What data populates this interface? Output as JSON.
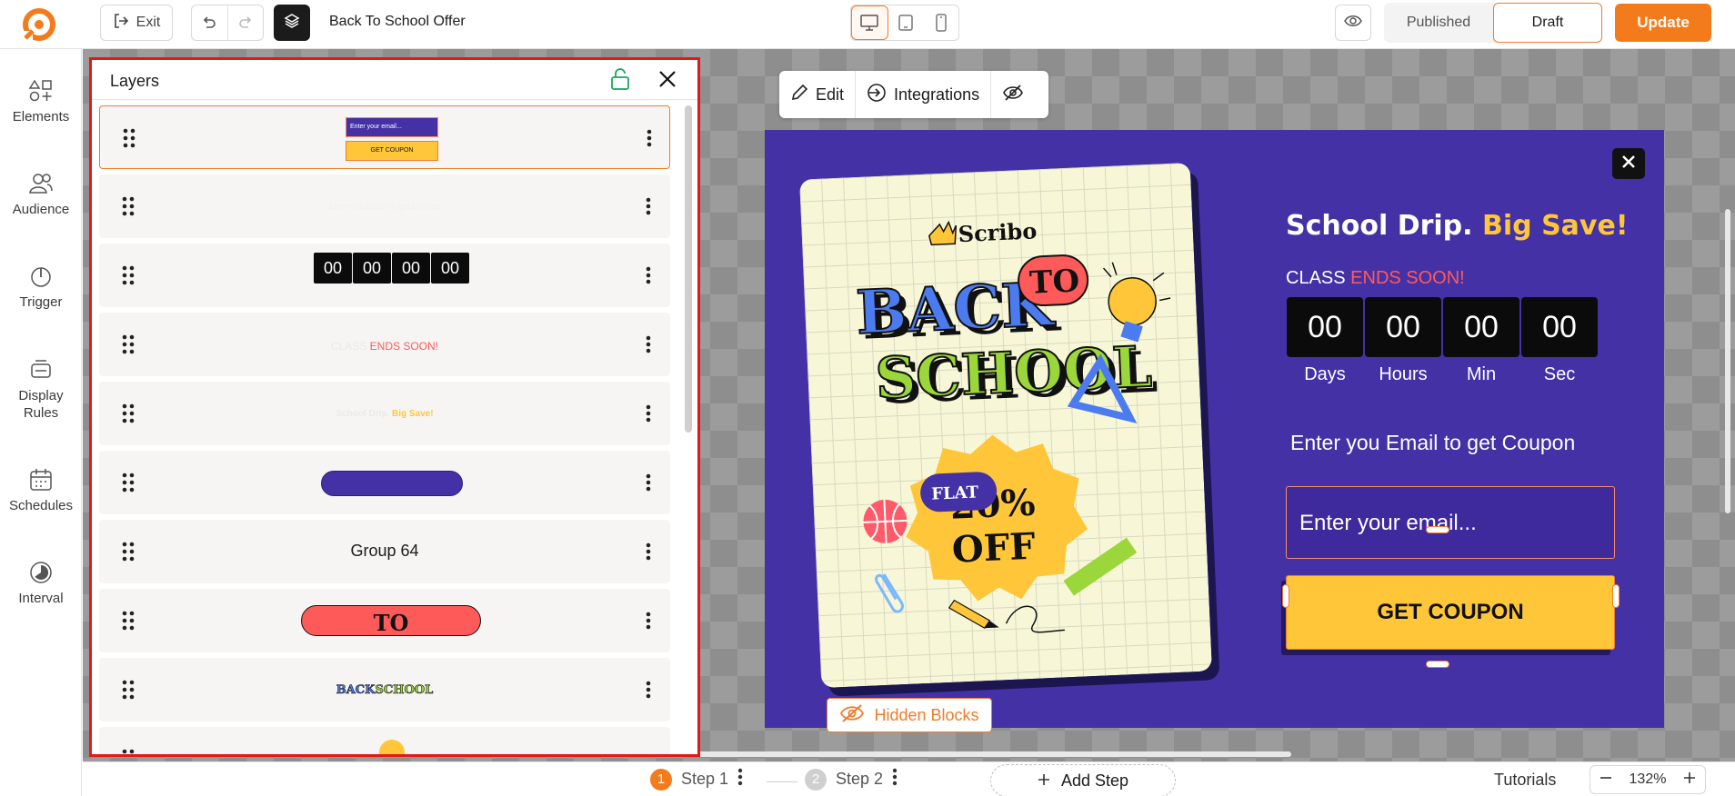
{
  "topbar": {
    "exit_label": "Exit",
    "campaign_title": "Back To School Offer",
    "status": {
      "published": "Published",
      "draft": "Draft"
    },
    "update_label": "Update",
    "accent": "#f47b1c"
  },
  "rail": {
    "items": [
      {
        "label": "Elements",
        "icon": "shapes-icon"
      },
      {
        "label": "Audience",
        "icon": "users-icon"
      },
      {
        "label": "Trigger",
        "icon": "power-icon"
      },
      {
        "label": "Display Rules",
        "icon": "display-rules-icon"
      },
      {
        "label": "Schedules",
        "icon": "calendar-icon"
      },
      {
        "label": "Interval",
        "icon": "interval-icon"
      }
    ]
  },
  "layers": {
    "title": "Layers",
    "rows": [
      {
        "label": "",
        "thumb": "email-and-coupon",
        "thumb_email": "Enter your email...",
        "thumb_button": "GET COUPON",
        "selected": true
      },
      {
        "label": "Enter you Email to get Coupon",
        "thumb": "text-faded"
      },
      {
        "label": "",
        "thumb": "countdown",
        "digits": [
          "00",
          "00",
          "00",
          "00"
        ]
      },
      {
        "label": "",
        "thumb": "class-ends",
        "text_a": "CLASS ",
        "text_b": "ENDS SOON!"
      },
      {
        "label": "",
        "thumb": "headline",
        "text_a": "School Drip. ",
        "text_b": "Big Save!"
      },
      {
        "label": "",
        "thumb": "purple-pill"
      },
      {
        "label": "Group 64",
        "thumb": "none"
      },
      {
        "label": "",
        "thumb": "to-pill",
        "text": "TO"
      },
      {
        "label": "",
        "thumb": "back-school",
        "text_a": "BACK",
        "text_b": "SCHOOL"
      },
      {
        "label": "",
        "thumb": "bulb-partial"
      }
    ]
  },
  "toolbar": {
    "edit": "Edit",
    "integrations": "Integrations"
  },
  "popup": {
    "poster": {
      "brand": "Scribo",
      "back": "BACK",
      "to": "TO",
      "school": "SCHOOL",
      "flat": "FLAT",
      "percent": "20%",
      "off": "OFF"
    },
    "headline_a": "School Drip.",
    "headline_b": "Big Save!",
    "sub_a": "CLASS",
    "sub_b": "ENDS SOON!",
    "countdown": [
      {
        "value": "00",
        "label": "Days"
      },
      {
        "value": "00",
        "label": "Hours"
      },
      {
        "value": "00",
        "label": "Min"
      },
      {
        "value": "00",
        "label": "Sec"
      }
    ],
    "email_prompt": "Enter you Email to get Coupon",
    "email_placeholder": "Enter your email...",
    "coupon_label": "GET COUPON",
    "colors": {
      "bg": "#4431a6",
      "yellow": "#ffc63a",
      "red": "#ff5a5a"
    }
  },
  "hidden_blocks_label": "Hidden Blocks",
  "bottombar": {
    "steps": [
      {
        "num": "1",
        "label": "Step 1"
      },
      {
        "num": "2",
        "label": "Step 2"
      }
    ],
    "add_step": "Add Step",
    "tutorials": "Tutorials",
    "zoom": "132%"
  }
}
